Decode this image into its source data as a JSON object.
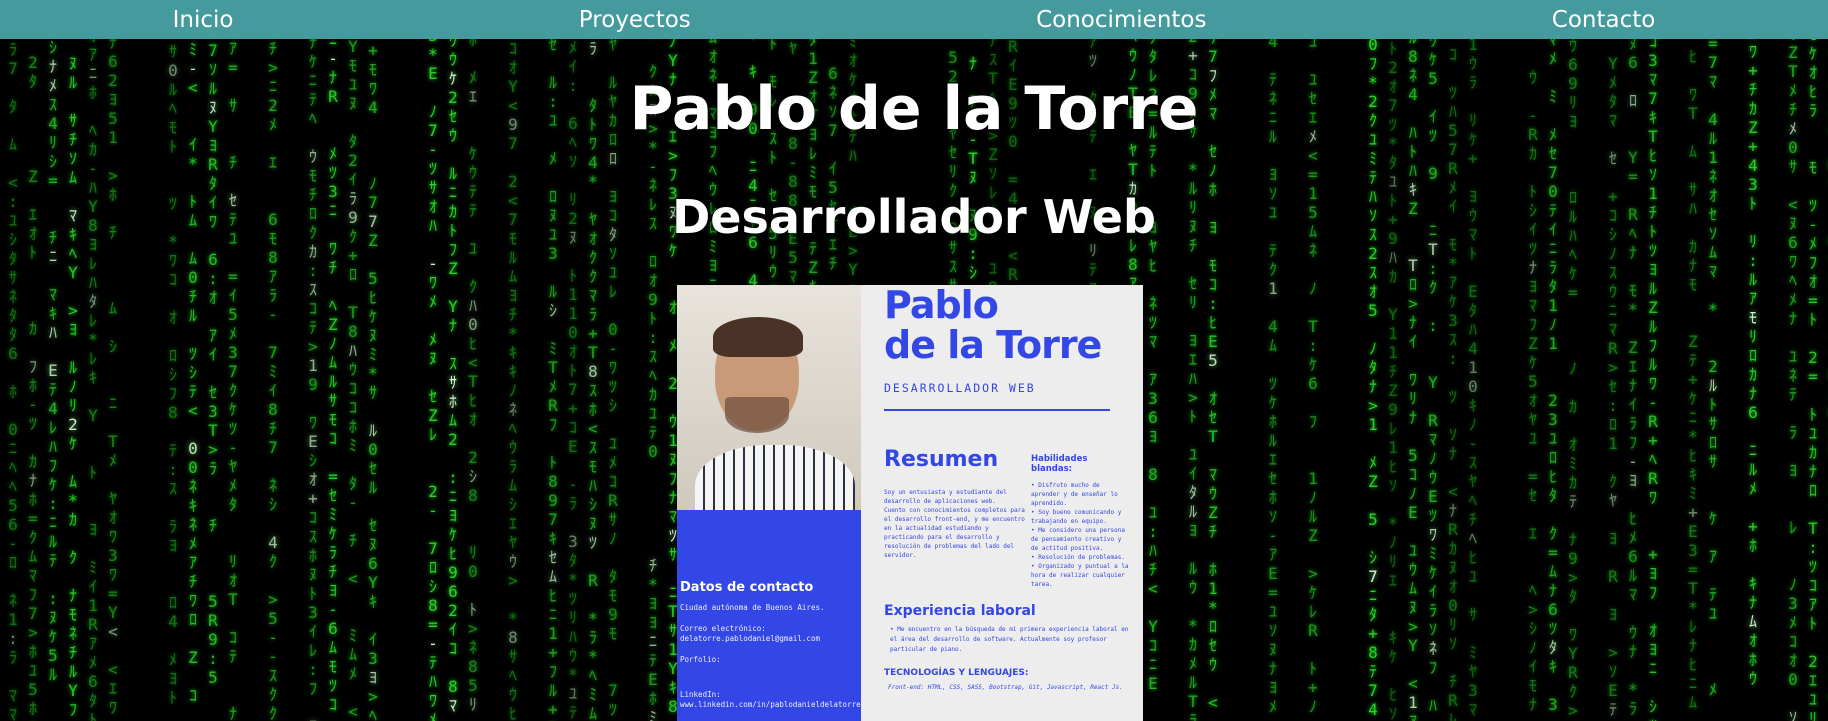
{
  "nav": {
    "items": [
      "Inicio",
      "Proyectos",
      "Conocimientos",
      "Contacto"
    ]
  },
  "header": {
    "title": "Pablo de la Torre",
    "subtitle": "Desarrollador Web"
  },
  "cv": {
    "name": "Pablo\nde la Torre",
    "role": "DESARROLLADOR WEB",
    "resumen_title": "Resumen",
    "resumen_text": "Soy un entusiasta y estudiante del desarrollo de aplicaciones web.\n Cuento con conocimientos completos para el desarrollo front-end, y me encuentro en la actualidad estudiando y practicando para el desarrollo y resolución de problemas del lado del servidor.",
    "soft_title": "Habilidades blandas:",
    "soft_items": [
      "Disfruto mucho de aprender y de enseñar lo aprendido.",
      "Soy bueno comunicando y trabajando en equipo.",
      "Me considero una persona de pensamiento creativo y de actitud positiva.",
      "Resolución de problemas.",
      "Organizado y puntual a la hora de realizar cualquier tarea."
    ],
    "exp_title": "Experiencia laboral",
    "exp_items": [
      "Me encuentro en la búsqueda de mi primera experiencia laboral en el área del desarrollo de software. Actualmente soy profesor particular de piano."
    ],
    "tech_title": "TECNOLOGÍAS Y LENGUAJES:",
    "tech_text": "Front-end: HTML, CSS, SASS, Bootstrap, Git, Javascript, React Js.",
    "contact_title": "Datos de contacto",
    "contact_city": "Ciudad autónoma de Buenos Aires.",
    "contact_email": "Correo electrónico:\ndelatorre.pablodaniel@gmail.com",
    "contact_portfolio": "Porfolio:",
    "contact_linkedin": "LinkedIn:\nwww.linkedin.com/in/pablodanieldelatorre"
  },
  "colors": {
    "nav_bg": "#449a9c",
    "matrix_green": "#2bd82b",
    "cv_blue": "#3346e6"
  }
}
